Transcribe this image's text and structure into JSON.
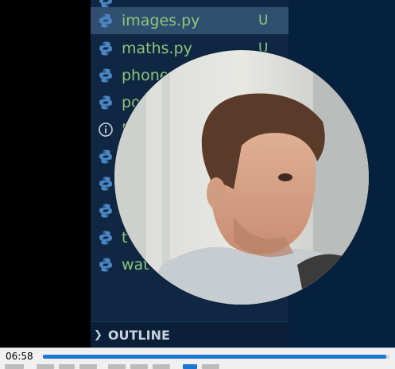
{
  "explorer": {
    "files": [
      {
        "name": "",
        "status": "",
        "icon": "python-icon"
      },
      {
        "name": "images.py",
        "status": "U",
        "icon": "python-icon",
        "selected": true
      },
      {
        "name": "maths.py",
        "status": "U",
        "icon": "python-icon"
      },
      {
        "name": "phone",
        "status": "",
        "icon": "python-icon"
      },
      {
        "name": "po",
        "status": "",
        "icon": "python-icon"
      },
      {
        "name": "R",
        "status": "",
        "icon": "info-icon"
      },
      {
        "name": "",
        "status": "",
        "icon": "python-icon"
      },
      {
        "name": "",
        "status": "",
        "icon": "python-icon"
      },
      {
        "name": "",
        "status": "",
        "icon": "python-icon"
      },
      {
        "name": "t",
        "status": "",
        "icon": "python-icon"
      },
      {
        "name": "wat",
        "status": "",
        "icon": "python-icon"
      }
    ],
    "outline_label": "OUTLINE"
  },
  "player": {
    "time": "06:58",
    "progress": 0.99
  },
  "colors": {
    "explorer_bg": "#0f2742",
    "file_text": "#8fc57c",
    "python_blue": "#4a86c4",
    "progress_fill": "#1d77d2"
  }
}
